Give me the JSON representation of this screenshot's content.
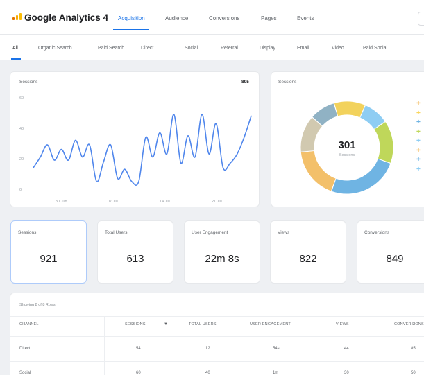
{
  "app": {
    "title": "Google Analytics 4"
  },
  "top_tabs": [
    {
      "label": "Acquisition",
      "active": true
    },
    {
      "label": "Audience",
      "active": false
    },
    {
      "label": "Conversions",
      "active": false
    },
    {
      "label": "Pages",
      "active": false
    },
    {
      "label": "Events",
      "active": false
    }
  ],
  "channels": [
    "All",
    "Organic Search",
    "Paid Search",
    "Direct",
    "Social",
    "Referral",
    "Display",
    "Email",
    "Video",
    "Paid Social"
  ],
  "active_channel": "All",
  "line_card": {
    "title": "Sessions",
    "total": "895",
    "y_ticks": [
      "60",
      "40",
      "20",
      "0"
    ],
    "x_ticks": [
      "30 Jun",
      "07 Jul",
      "14 Jul",
      "21 Jul"
    ]
  },
  "chart_data": {
    "type": "line",
    "title": "Sessions",
    "ylim": [
      0,
      60
    ],
    "x": [
      1,
      2,
      3,
      4,
      5,
      6,
      7,
      8,
      9,
      10,
      11,
      12,
      13,
      14,
      15,
      16,
      17,
      18,
      19,
      20,
      21,
      22,
      23,
      24,
      25,
      26,
      27,
      28,
      29,
      30,
      31,
      32
    ],
    "series": [
      {
        "values": [
          15,
          22,
          30,
          20,
          27,
          20,
          33,
          22,
          30,
          6,
          19,
          30,
          8,
          14,
          6,
          6,
          35,
          22,
          38,
          24,
          50,
          18,
          36,
          22,
          50,
          24,
          44,
          15,
          18,
          24,
          35,
          49
        ]
      }
    ]
  },
  "donut_card": {
    "title": "Sessions",
    "center_value": "301",
    "center_label": "Sessions",
    "segments": [
      {
        "value": 9,
        "color": "#90b2c4"
      },
      {
        "value": 11,
        "color": "#f2d25c"
      },
      {
        "value": 9,
        "color": "#8ecdf3"
      },
      {
        "value": 15,
        "color": "#bfd75a"
      },
      {
        "value": 25,
        "color": "#6fb4e3"
      },
      {
        "value": 18,
        "color": "#f3c06a"
      },
      {
        "value": 13,
        "color": "#d1c9b0"
      }
    ],
    "legend_colors": [
      "#f3c06a",
      "#f9d65c",
      "#6fb4e3",
      "#bfd75a",
      "#8ecdf3",
      "#f3c06a",
      "#6fb4e3",
      "#8ecdf3"
    ]
  },
  "metrics": [
    {
      "label": "Sessions",
      "value": "921",
      "active": true
    },
    {
      "label": "Total Users",
      "value": "613",
      "active": false
    },
    {
      "label": "User Engagement",
      "value": "22m 8s",
      "active": false
    },
    {
      "label": "Views",
      "value": "822",
      "active": false
    },
    {
      "label": "Conversions",
      "value": "849",
      "active": false
    }
  ],
  "table": {
    "caption": "Showing 8 of 8 Rows",
    "sort_indicator": "▼",
    "columns": [
      "CHANNEL",
      "SESSIONS",
      "TOTAL USERS",
      "USER ENGAGEMENT",
      "VIEWS",
      "CONVERSIONS"
    ],
    "rows": [
      [
        "Direct",
        "54",
        "12",
        "54s",
        "44",
        "85"
      ],
      [
        "Social",
        "60",
        "40",
        "1m",
        "30",
        "50"
      ]
    ]
  },
  "colors": {
    "accent": "#1a73e8",
    "line": "#4f86ec"
  }
}
